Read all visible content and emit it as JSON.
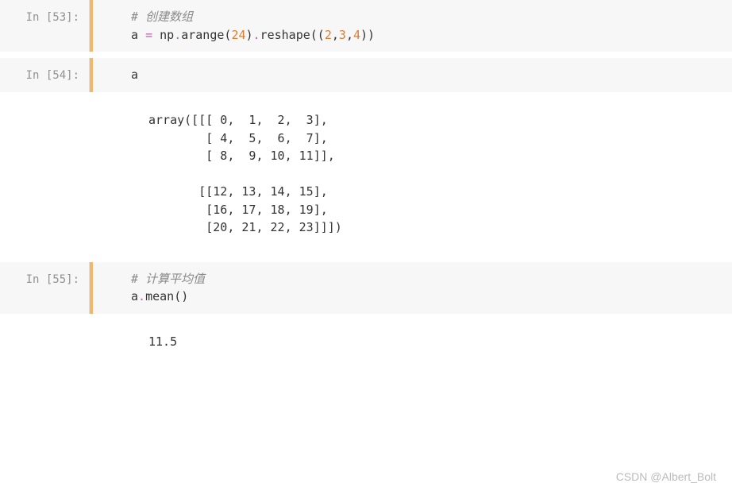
{
  "cells": [
    {
      "prompt": "In [53]:",
      "code": {
        "comment": "# 创建数组",
        "line2_prefix": "a ",
        "line2_eq": "= ",
        "line2_np": "np",
        "line2_dot1": ".",
        "line2_arange": "arange",
        "line2_open1": "(",
        "line2_num1": "24",
        "line2_close1": ")",
        "line2_dot2": ".",
        "line2_reshape": "reshape",
        "line2_open2": "((",
        "line2_n2": "2",
        "line2_c1": ",",
        "line2_n3": "3",
        "line2_c2": ",",
        "line2_n4": "4",
        "line2_close2": "))"
      }
    },
    {
      "prompt": "In [54]:",
      "code": {
        "line": "a"
      },
      "output": "array([[[ 0,  1,  2,  3],\n        [ 4,  5,  6,  7],\n        [ 8,  9, 10, 11]],\n\n       [[12, 13, 14, 15],\n        [16, 17, 18, 19],\n        [20, 21, 22, 23]]])"
    },
    {
      "prompt": "In [55]:",
      "code": {
        "comment": "# 计算平均值",
        "line2_a": "a",
        "line2_dot": ".",
        "line2_mean": "mean",
        "line2_parens": "()"
      },
      "output": "11.5"
    }
  ],
  "watermark": "CSDN @Albert_Bolt"
}
